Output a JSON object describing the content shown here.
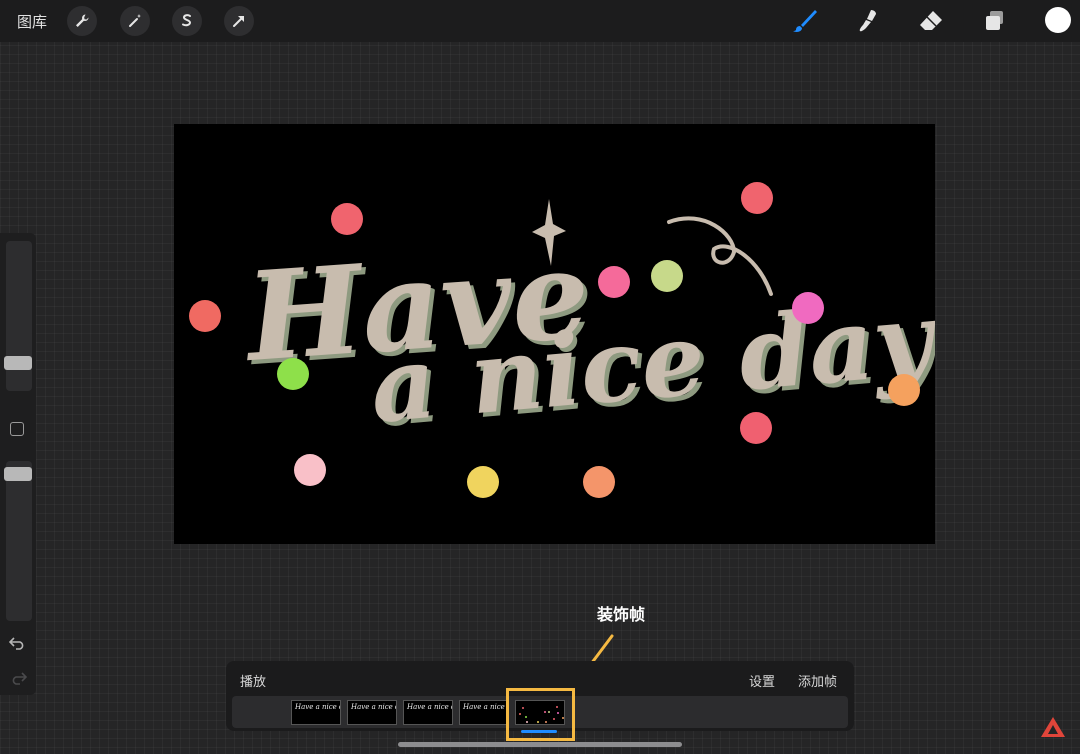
{
  "topbar": {
    "gallery_label": "图库",
    "left_tools": [
      "wrench-icon",
      "magic-wand-icon",
      "selection-icon",
      "transform-arrow-icon"
    ],
    "right_tools": [
      "brush-icon",
      "smudge-icon",
      "eraser-icon",
      "layers-icon"
    ],
    "active_tool": "brush-icon",
    "active_color": "#ffffff",
    "accent_color": "#1f8cff"
  },
  "sidebar": {
    "modifier_icon": "square-icon",
    "undo_icon": "undo-icon",
    "redo_icon": "redo-icon"
  },
  "canvas": {
    "line1": "Have",
    "line2": "a nice day",
    "background_color": "#000000",
    "lettering_color": "#c8bcae"
  },
  "annotation": {
    "label": "装饰帧",
    "highlight_color": "#f5b942"
  },
  "timeline": {
    "play_label": "播放",
    "settings_label": "设置",
    "add_frame_label": "添加帧",
    "frames": [
      {
        "text": "Have a nice day"
      },
      {
        "text": "Have a nice day"
      },
      {
        "text": "Have a nice day"
      },
      {
        "text": "Have a nice day"
      },
      {
        "text": ""
      }
    ],
    "selected_frame": 5
  }
}
